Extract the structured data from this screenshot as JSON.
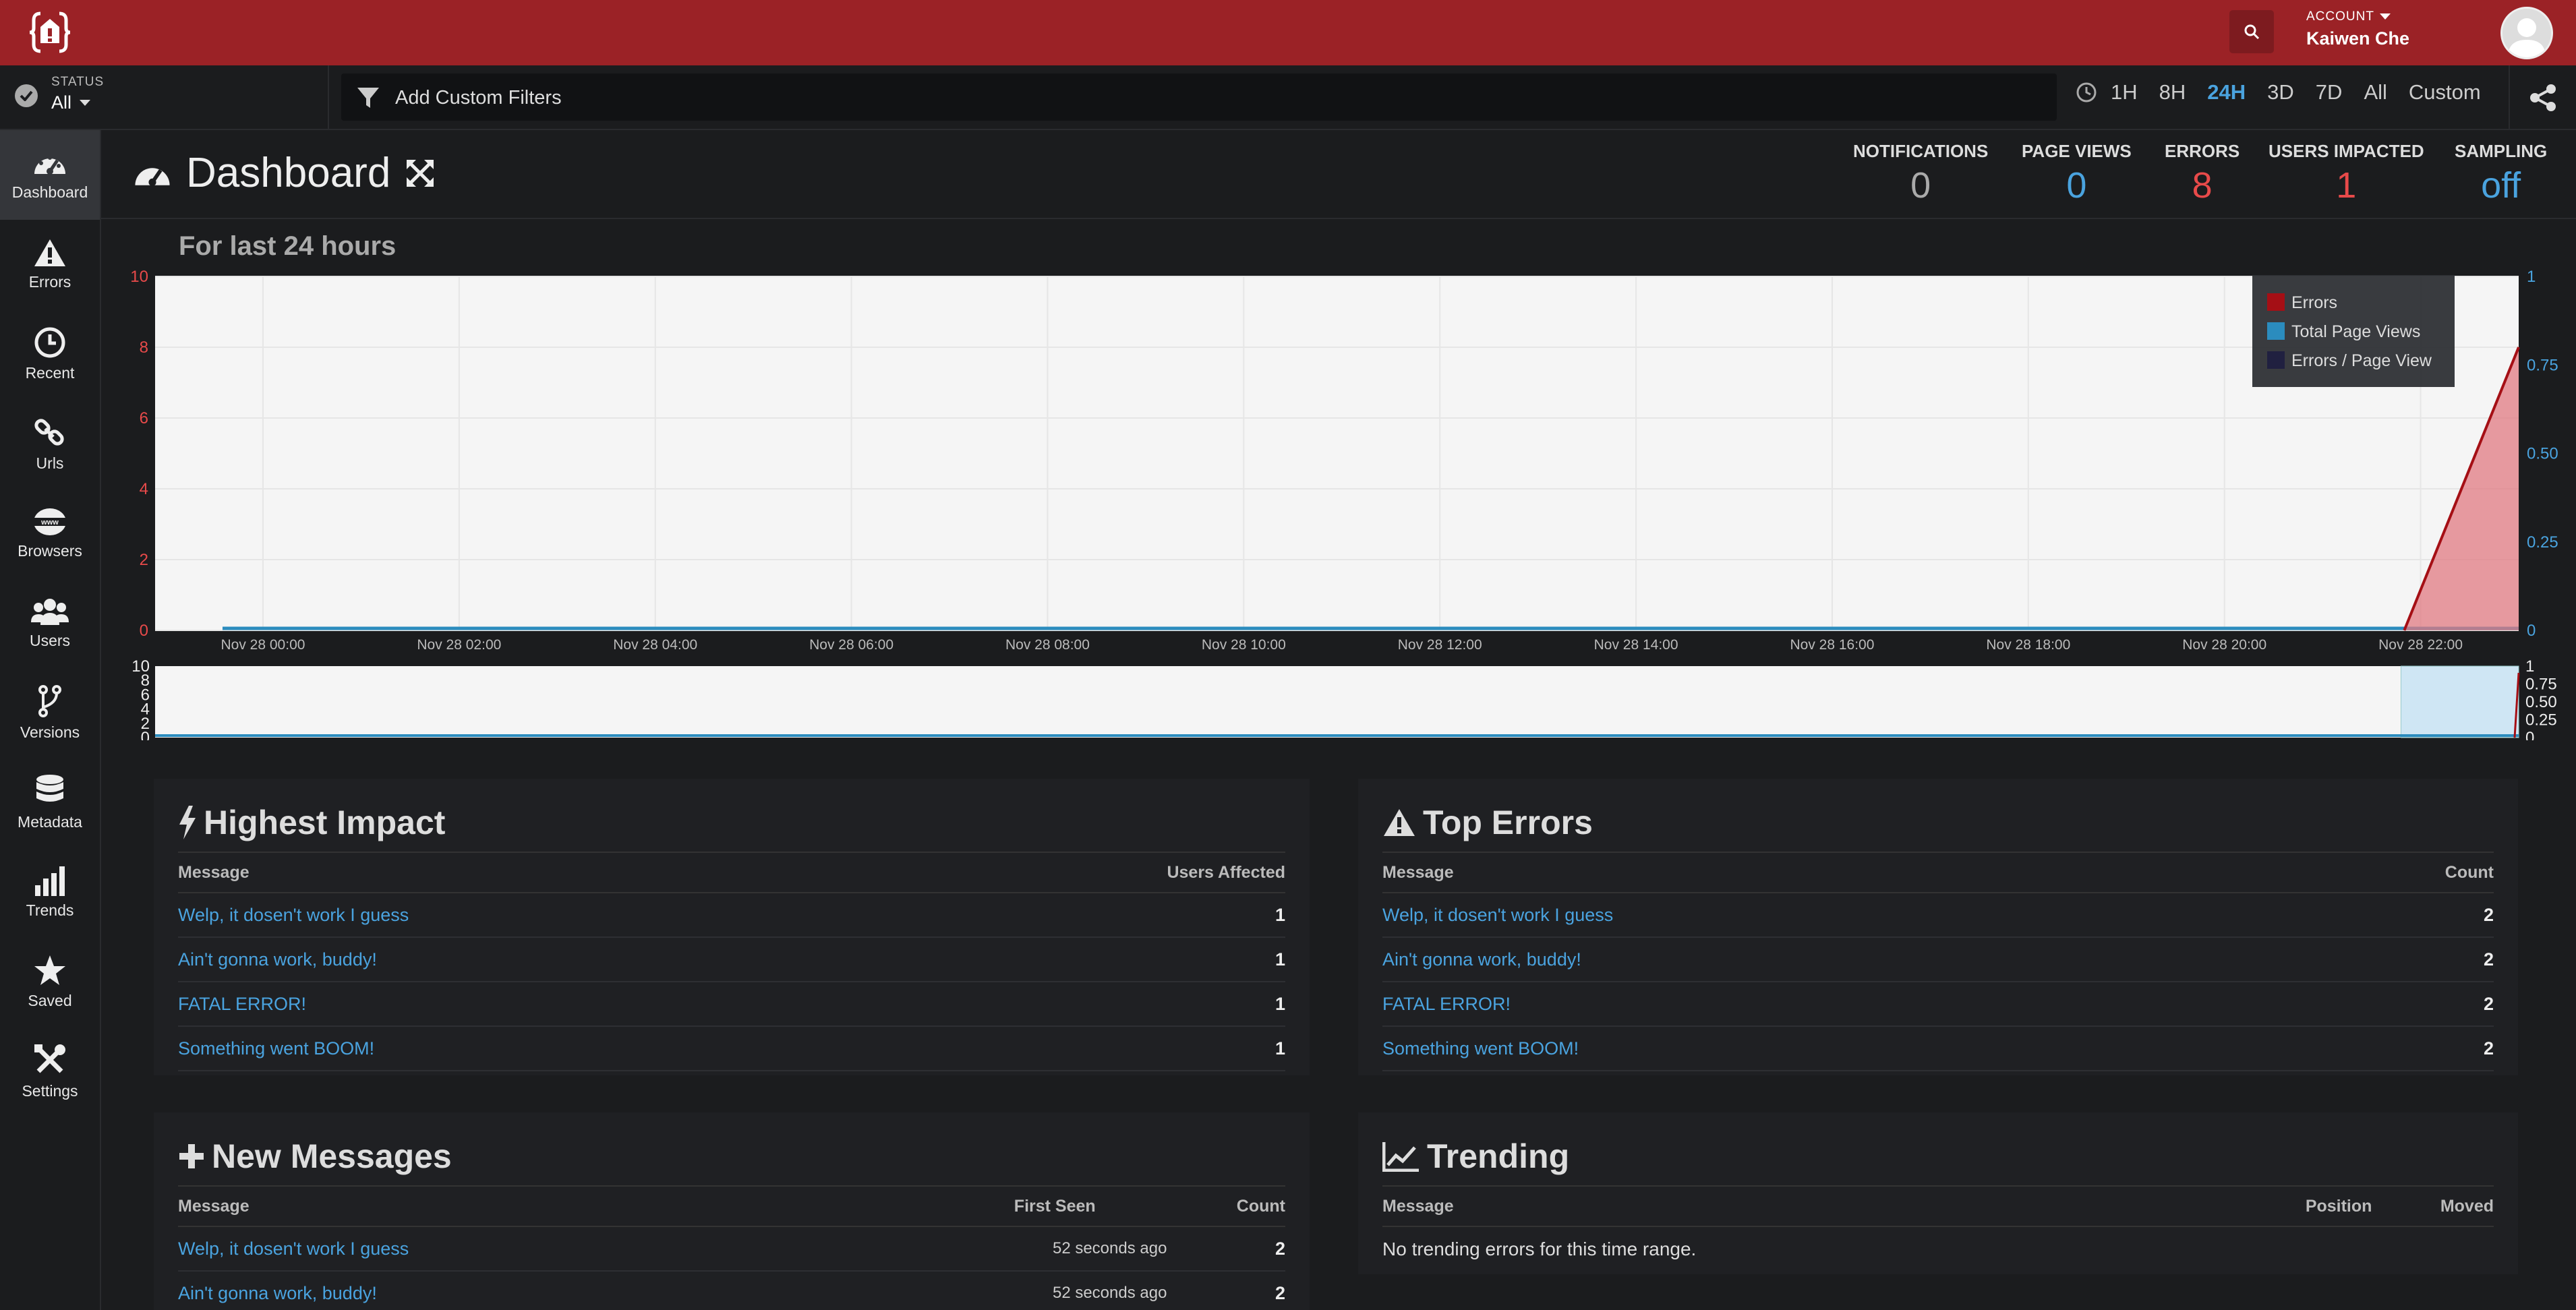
{
  "header": {
    "account_label": "ACCOUNT",
    "account_name": "Kaiwen Che"
  },
  "filterbar": {
    "status_label": "STATUS",
    "status_value": "All",
    "filter_placeholder": "Add Custom Filters",
    "ranges": [
      "1H",
      "8H",
      "24H",
      "3D",
      "7D",
      "All",
      "Custom"
    ],
    "active_range": "24H"
  },
  "sidebar": {
    "items": [
      {
        "label": "Dashboard",
        "icon": "dashboard-icon"
      },
      {
        "label": "Errors",
        "icon": "warning-icon"
      },
      {
        "label": "Recent",
        "icon": "clock-icon"
      },
      {
        "label": "Urls",
        "icon": "link-icon"
      },
      {
        "label": "Browsers",
        "icon": "www-icon"
      },
      {
        "label": "Users",
        "icon": "users-icon"
      },
      {
        "label": "Versions",
        "icon": "branch-icon"
      },
      {
        "label": "Metadata",
        "icon": "database-icon"
      },
      {
        "label": "Trends",
        "icon": "bar-chart-icon"
      },
      {
        "label": "Saved",
        "icon": "star-icon"
      },
      {
        "label": "Settings",
        "icon": "tools-icon"
      }
    ]
  },
  "page": {
    "title": "Dashboard",
    "stats": [
      {
        "label": "NOTIFICATIONS",
        "value": "0",
        "color": "#aaaaaa"
      },
      {
        "label": "PAGE VIEWS",
        "value": "0",
        "color": "#4aa3df"
      },
      {
        "label": "ERRORS",
        "value": "8",
        "color": "#e84a4a"
      },
      {
        "label": "USERS IMPACTED",
        "value": "1",
        "color": "#e84a4a"
      },
      {
        "label": "SAMPLING",
        "value": "off",
        "color": "#4aa3df"
      }
    ],
    "chart_title": "For last 24 hours"
  },
  "chart_data": {
    "type": "area",
    "title": "For last 24 hours",
    "x_ticks": [
      "Nov 28 00:00",
      "Nov 28 02:00",
      "Nov 28 04:00",
      "Nov 28 06:00",
      "Nov 28 08:00",
      "Nov 28 10:00",
      "Nov 28 12:00",
      "Nov 28 14:00",
      "Nov 28 16:00",
      "Nov 28 18:00",
      "Nov 28 20:00",
      "Nov 28 22:00"
    ],
    "y_left_ticks": [
      "0",
      "2",
      "4",
      "6",
      "8",
      "10"
    ],
    "y_right_ticks": [
      "0",
      "0.25",
      "0.50",
      "0.75",
      "1"
    ],
    "ylim_left": [
      0,
      10
    ],
    "ylim_right": [
      0,
      1
    ],
    "legend": [
      "Errors",
      "Total Page Views",
      "Errors / Page View"
    ],
    "legend_colors": [
      "#a50f15",
      "#2b8cbe",
      "#202040"
    ],
    "legend_position": "top-right",
    "series": [
      {
        "name": "Errors",
        "points": [
          [
            "Nov 28 21:50",
            0
          ],
          [
            "Nov 28 23:00",
            8
          ]
        ]
      },
      {
        "name": "Total Page Views",
        "points": [
          [
            "Nov 28 00:00",
            0
          ],
          [
            "Nov 28 23:00",
            0
          ]
        ]
      }
    ],
    "mini_y_left_ticks": [
      "0",
      "2",
      "4",
      "6",
      "8",
      "10"
    ],
    "mini_y_right_ticks": [
      "0",
      "0.25",
      "0.50",
      "0.75",
      "1"
    ]
  },
  "panels": {
    "highest_impact": {
      "title": "Highest Impact",
      "col_message": "Message",
      "col_value": "Users Affected",
      "rows": [
        {
          "message": "Welp, it dosen't work I guess",
          "value": "1"
        },
        {
          "message": "Ain't gonna work, buddy!",
          "value": "1"
        },
        {
          "message": "FATAL ERROR!",
          "value": "1"
        },
        {
          "message": "Something went BOOM!",
          "value": "1"
        }
      ]
    },
    "top_errors": {
      "title": "Top Errors",
      "col_message": "Message",
      "col_value": "Count",
      "rows": [
        {
          "message": "Welp, it dosen't work I guess",
          "value": "2"
        },
        {
          "message": "Ain't gonna work, buddy!",
          "value": "2"
        },
        {
          "message": "FATAL ERROR!",
          "value": "2"
        },
        {
          "message": "Something went BOOM!",
          "value": "2"
        }
      ]
    },
    "new_messages": {
      "title": "New Messages",
      "col_message": "Message",
      "col_first_seen": "First Seen",
      "col_count": "Count",
      "rows": [
        {
          "message": "Welp, it dosen't work I guess",
          "first_seen": "52 seconds ago",
          "count": "2"
        },
        {
          "message": "Ain't gonna work, buddy!",
          "first_seen": "52 seconds ago",
          "count": "2"
        }
      ]
    },
    "trending": {
      "title": "Trending",
      "col_message": "Message",
      "col_position": "Position",
      "col_moved": "Moved",
      "empty": "No trending errors for this time range."
    }
  }
}
